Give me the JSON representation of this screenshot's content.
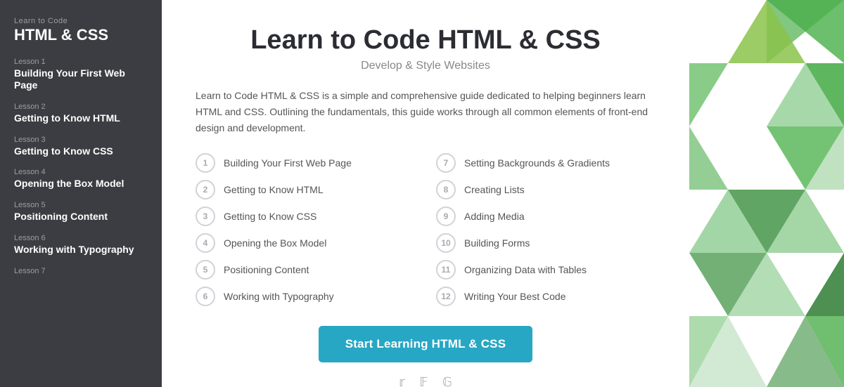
{
  "sidebar": {
    "subtitle": "Learn to Code",
    "title": "HTML & CSS",
    "lessons": [
      {
        "label": "Lesson 1",
        "name": "Building Your First Web Page"
      },
      {
        "label": "Lesson 2",
        "name": "Getting to Know HTML"
      },
      {
        "label": "Lesson 3",
        "name": "Getting to Know CSS"
      },
      {
        "label": "Lesson 4",
        "name": "Opening the Box Model"
      },
      {
        "label": "Lesson 5",
        "name": "Positioning Content"
      },
      {
        "label": "Lesson 6",
        "name": "Working with Typography"
      },
      {
        "label": "Lesson 7",
        "name": ""
      }
    ]
  },
  "main": {
    "title": "Learn to Code HTML & CSS",
    "subtitle": "Develop & Style Websites",
    "description": "Learn to Code HTML & CSS is a simple and comprehensive guide dedicated to helping beginners learn HTML and CSS. Outlining the fundamentals, this guide works through all common elements of front-end design and development.",
    "cta_label": "Start Learning HTML & CSS",
    "lessons": [
      {
        "num": "1",
        "name": "Building Your First Web Page"
      },
      {
        "num": "7",
        "name": "Setting Backgrounds & Gradients"
      },
      {
        "num": "2",
        "name": "Getting to Know HTML"
      },
      {
        "num": "8",
        "name": "Creating Lists"
      },
      {
        "num": "3",
        "name": "Getting to Know CSS"
      },
      {
        "num": "9",
        "name": "Adding Media"
      },
      {
        "num": "4",
        "name": "Opening the Box Model"
      },
      {
        "num": "10",
        "name": "Building Forms"
      },
      {
        "num": "5",
        "name": "Positioning Content"
      },
      {
        "num": "11",
        "name": "Organizing Data with Tables"
      },
      {
        "num": "6",
        "name": "Working with Typography"
      },
      {
        "num": "12",
        "name": "Writing Your Best Code"
      }
    ]
  }
}
